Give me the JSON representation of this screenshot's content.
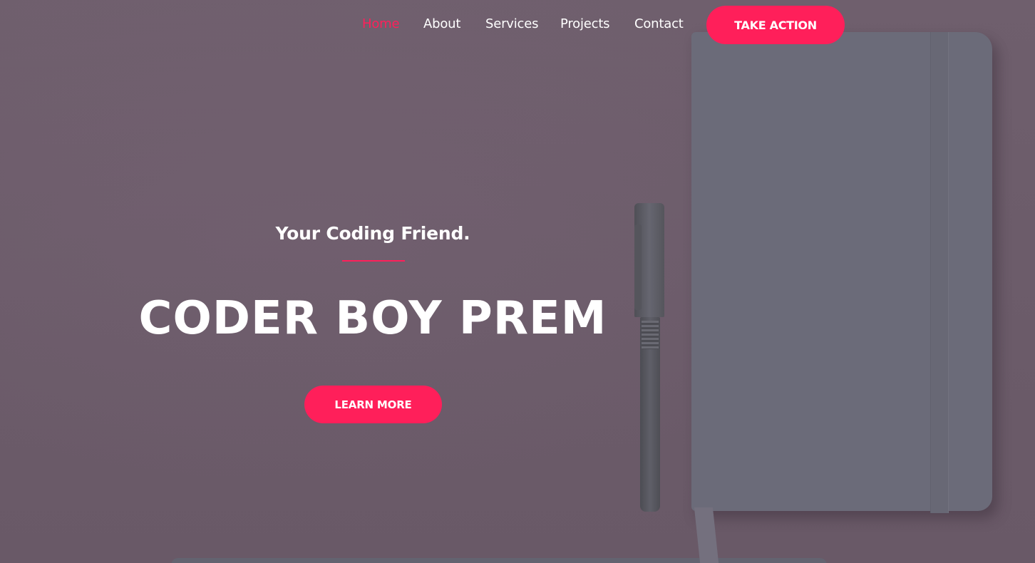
{
  "nav": {
    "items": [
      {
        "label": "Home",
        "active": true
      },
      {
        "label": "About",
        "active": false
      },
      {
        "label": "Services",
        "active": false
      },
      {
        "label": "Projects",
        "active": false
      },
      {
        "label": "Contact",
        "active": false
      }
    ],
    "cta_label": "TAKE ACTION"
  },
  "hero": {
    "subtitle": "Your Coding Friend.",
    "title": "CODER BOY PREM",
    "button_label": "LEARN MORE",
    "background_image": "desk-notebook-pen-photo"
  },
  "colors": {
    "accent": "#ff1f5a",
    "overlay": "#6e5e6c",
    "text": "#ffffff"
  }
}
